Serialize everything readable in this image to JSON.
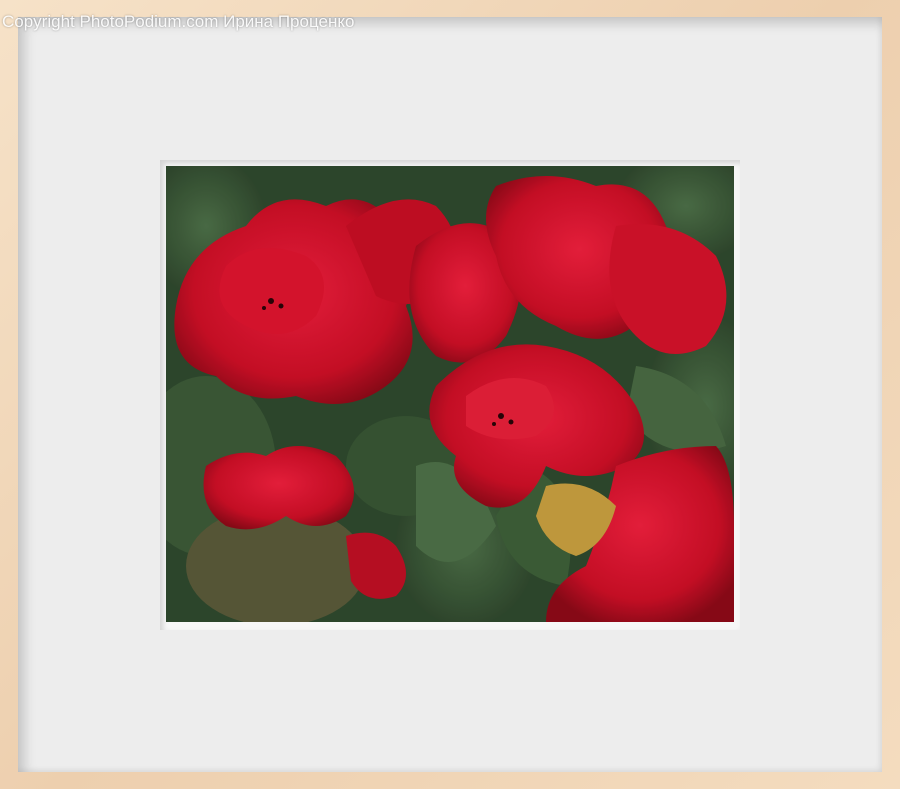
{
  "watermark": {
    "text": "Copyright PhotoPodium.com Ирина Проценко"
  },
  "colors": {
    "frame": "#f1d9bc",
    "mat": "#ededed",
    "petal": "#d2102a",
    "leaf": "#3f5e3a"
  }
}
